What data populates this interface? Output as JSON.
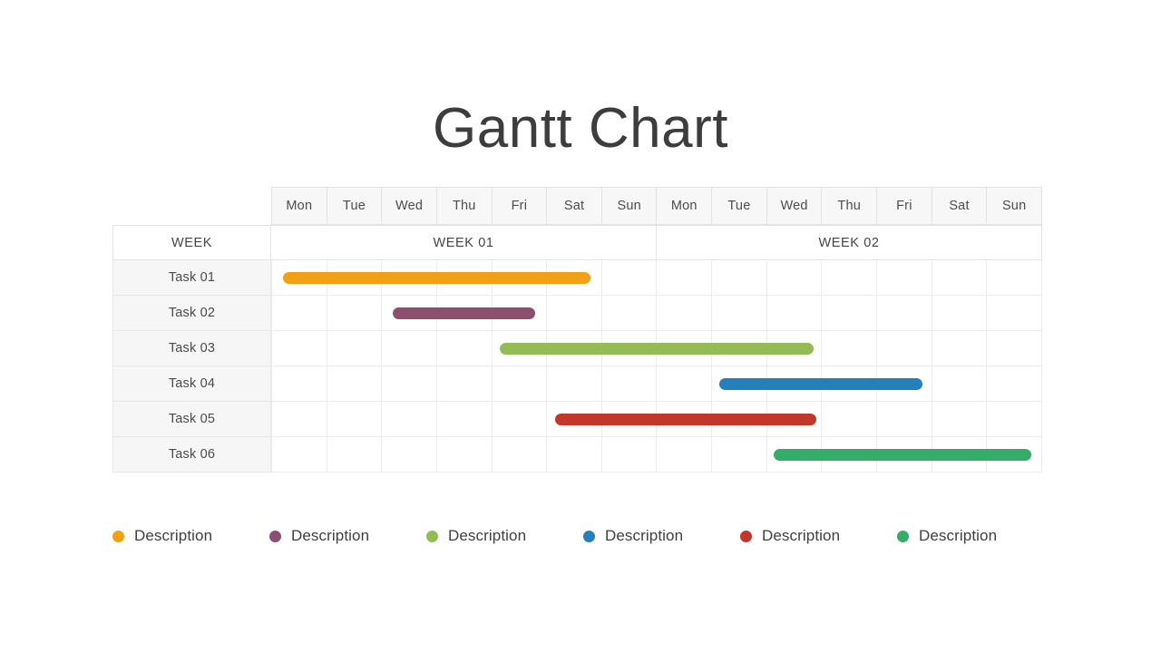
{
  "title": "Gantt Chart",
  "table": {
    "week_row_label": "WEEK",
    "day_headers": [
      "Mon",
      "Tue",
      "Wed",
      "Thu",
      "Fri",
      "Sat",
      "Sun",
      "Mon",
      "Tue",
      "Wed",
      "Thu",
      "Fri",
      "Sat",
      "Sun"
    ],
    "weeks": [
      {
        "label": "WEEK 01",
        "span": 7
      },
      {
        "label": "WEEK 02",
        "span": 7
      }
    ],
    "tasks": [
      {
        "label": "Task 01"
      },
      {
        "label": "Task 02"
      },
      {
        "label": "Task 03"
      },
      {
        "label": "Task 04"
      },
      {
        "label": "Task 05"
      },
      {
        "label": "Task 06"
      }
    ]
  },
  "legend": {
    "items": [
      {
        "label": "Description",
        "color": "#EFA014"
      },
      {
        "label": "Description",
        "color": "#8E4F6E"
      },
      {
        "label": "Description",
        "color": "#93BC56"
      },
      {
        "label": "Description",
        "color": "#2480BC"
      },
      {
        "label": "Description",
        "color": "#C1382B"
      },
      {
        "label": "Description",
        "color": "#35AC67"
      }
    ]
  },
  "chart_data": {
    "type": "bar",
    "chart_kind": "gantt",
    "title": "Gantt Chart",
    "xlabel": "",
    "ylabel": "",
    "grid": true,
    "legend_position": "bottom",
    "x_axis": {
      "unit": "day",
      "total_columns": 14,
      "tick_labels": [
        "Mon",
        "Tue",
        "Wed",
        "Thu",
        "Fri",
        "Sat",
        "Sun",
        "Mon",
        "Tue",
        "Wed",
        "Thu",
        "Fri",
        "Sat",
        "Sun"
      ],
      "groups": [
        "WEEK 01",
        "WEEK 02"
      ]
    },
    "categories": [
      "Task 01",
      "Task 02",
      "Task 03",
      "Task 04",
      "Task 05",
      "Task 06"
    ],
    "series": [
      {
        "name": "Task 01",
        "color": "#EFA014",
        "start_day": 0.21,
        "end_day": 5.8,
        "duration_days": 5.59,
        "start_label": "WEEK 01 Mon",
        "end_label": "WEEK 01 Sat"
      },
      {
        "name": "Task 02",
        "color": "#8E4F6E",
        "start_day": 2.2,
        "end_day": 4.8,
        "duration_days": 2.6,
        "start_label": "WEEK 01 Wed",
        "end_label": "WEEK 01 Fri"
      },
      {
        "name": "Task 03",
        "color": "#93BC56",
        "start_day": 4.15,
        "end_day": 9.85,
        "duration_days": 5.7,
        "start_label": "WEEK 01 Fri",
        "end_label": "WEEK 02 Wed"
      },
      {
        "name": "Task 04",
        "color": "#2480BC",
        "start_day": 8.14,
        "end_day": 11.83,
        "duration_days": 3.69,
        "start_label": "WEEK 02 Tue",
        "end_label": "WEEK 02 Fri"
      },
      {
        "name": "Task 05",
        "color": "#C1382B",
        "start_day": 5.15,
        "end_day": 9.9,
        "duration_days": 4.75,
        "start_label": "WEEK 01 Sat",
        "end_label": "WEEK 02 Wed"
      },
      {
        "name": "Task 06",
        "color": "#35AC67",
        "start_day": 9.12,
        "end_day": 13.81,
        "duration_days": 4.69,
        "start_label": "WEEK 02 Wed",
        "end_label": "WEEK 02 Sun"
      }
    ]
  }
}
